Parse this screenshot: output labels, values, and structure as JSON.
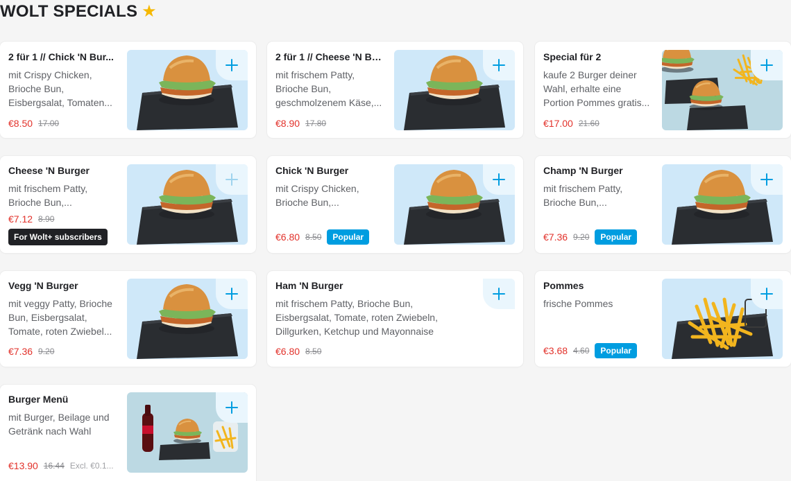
{
  "section": {
    "title": "WOLT SPECIALS",
    "icon": "star-icon"
  },
  "colors": {
    "accent": "#009de0",
    "price": "#e2312a",
    "badge_dark": "#202125"
  },
  "items": [
    {
      "name": "2 für 1 // Chick 'N Bur...",
      "desc": "mit Crispy Chicken, Brioche Bun, Eisbergsalat, Tomaten...",
      "price": "€8.50",
      "old_price": "17.00"
    },
    {
      "name": "2 für 1 // Cheese 'N Bu...",
      "desc": "mit frischem Patty, Brioche Bun, geschmolzenem Käse,...",
      "price": "€8.90",
      "old_price": "17.80"
    },
    {
      "name": "Special für 2",
      "desc": "kaufe 2 Burger deiner Wahl, erhalte eine Portion Pommes gratis...",
      "price": "€17.00",
      "old_price": "21.60"
    },
    {
      "name": "Cheese 'N Burger",
      "desc": "mit frischem Patty, Brioche Bun,...",
      "price": "€7.12",
      "old_price": "8.90",
      "sub_badge": "For Wolt+ subscribers"
    },
    {
      "name": "Chick 'N Burger",
      "desc": "mit Crispy Chicken, Brioche Bun,...",
      "price": "€6.80",
      "old_price": "8.50",
      "badge": "Popular"
    },
    {
      "name": "Champ 'N Burger",
      "desc": "mit frischem Patty, Brioche Bun,...",
      "price": "€7.36",
      "old_price": "9.20",
      "badge": "Popular"
    },
    {
      "name": "Vegg 'N Burger",
      "desc": "mit veggy Patty, Brioche Bun, Eisbergsalat, Tomate, roten Zwiebel...",
      "price": "€7.36",
      "old_price": "9.20"
    },
    {
      "name": "Ham 'N Burger",
      "desc": "mit frischem Patty, Brioche Bun, Eisbergsalat, Tomate, roten Zwiebeln, Dillgurken, Ketchup und Mayonnaise",
      "price": "€6.80",
      "old_price": "8.50"
    },
    {
      "name": "Pommes",
      "desc": "frische Pommes",
      "price": "€3.68",
      "old_price": "4.60",
      "badge": "Popular"
    },
    {
      "name": "Burger Menü",
      "desc": "mit Burger, Beilage und Getränk nach Wahl",
      "price": "€13.90",
      "old_price": "16.44",
      "excl": "Excl. €0.1..."
    }
  ]
}
